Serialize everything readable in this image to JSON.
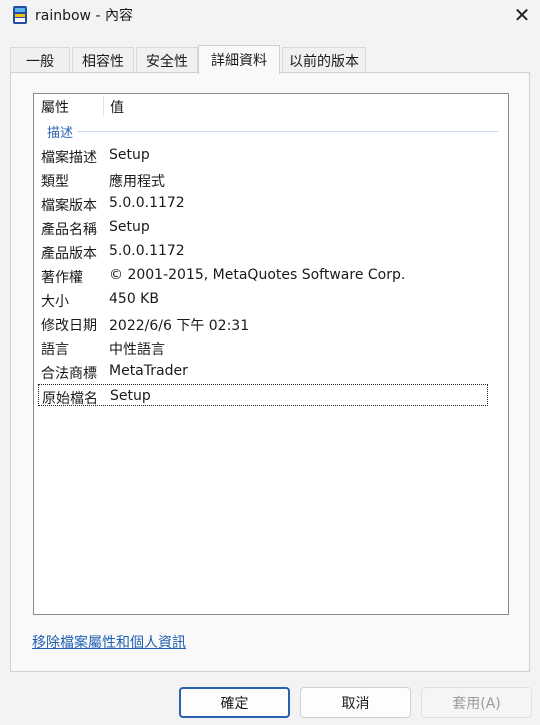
{
  "window": {
    "title": "rainbow - 內容",
    "icon": "app-icon",
    "close_glyph": "✕"
  },
  "tabs": [
    {
      "label": "一般",
      "active": false
    },
    {
      "label": "相容性",
      "active": false
    },
    {
      "label": "安全性",
      "active": false
    },
    {
      "label": "詳細資料",
      "active": true
    },
    {
      "label": "以前的版本",
      "active": false
    }
  ],
  "details": {
    "header_property": "屬性",
    "header_value": "值",
    "group_label": "描述",
    "rows": [
      {
        "name": "檔案描述",
        "value": "Setup"
      },
      {
        "name": "類型",
        "value": "應用程式"
      },
      {
        "name": "檔案版本",
        "value": "5.0.0.1172"
      },
      {
        "name": "產品名稱",
        "value": "Setup"
      },
      {
        "name": "產品版本",
        "value": "5.0.0.1172"
      },
      {
        "name": "著作權",
        "value": "© 2001-2015, MetaQuotes Software Corp."
      },
      {
        "name": "大小",
        "value": "450 KB"
      },
      {
        "name": "修改日期",
        "value": "2022/6/6 下午 02:31"
      },
      {
        "name": "語言",
        "value": "中性語言"
      },
      {
        "name": "合法商標",
        "value": "MetaTrader"
      },
      {
        "name": "原始檔名",
        "value": "Setup",
        "selected": true
      }
    ]
  },
  "remove_link": "移除檔案屬性和個人資訊",
  "buttons": {
    "ok": "確定",
    "cancel": "取消",
    "apply": "套用(A)"
  },
  "colors": {
    "accent": "#2a62b0",
    "link": "#1f5fb3",
    "group": "#2b66b8"
  }
}
